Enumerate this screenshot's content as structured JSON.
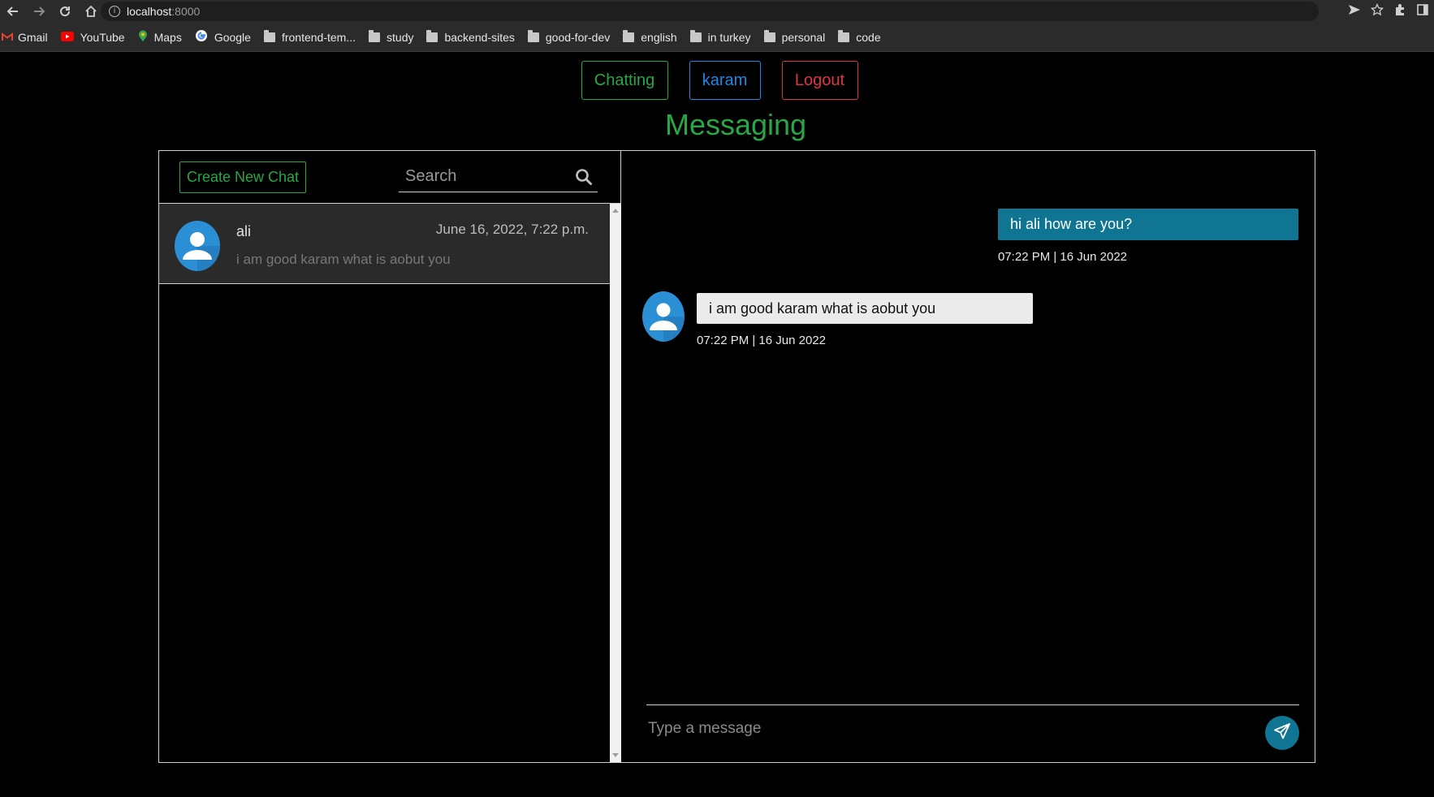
{
  "browser": {
    "url_host": "localhost",
    "url_port": ":8000",
    "bookmarks": [
      {
        "label": "Gmail",
        "icon": "gmail-icon"
      },
      {
        "label": "YouTube",
        "icon": "youtube-icon"
      },
      {
        "label": "Maps",
        "icon": "maps-icon"
      },
      {
        "label": "Google",
        "icon": "google-icon"
      },
      {
        "label": "frontend-tem...",
        "icon": "folder-icon"
      },
      {
        "label": "study",
        "icon": "folder-icon"
      },
      {
        "label": "backend-sites",
        "icon": "folder-icon"
      },
      {
        "label": "good-for-dev",
        "icon": "folder-icon"
      },
      {
        "label": "english",
        "icon": "folder-icon"
      },
      {
        "label": "in turkey",
        "icon": "folder-icon"
      },
      {
        "label": "personal",
        "icon": "folder-icon"
      },
      {
        "label": "code",
        "icon": "folder-icon"
      }
    ]
  },
  "nav": {
    "chatting_label": "Chatting",
    "user_label": "karam",
    "logout_label": "Logout"
  },
  "page": {
    "title": "Messaging"
  },
  "sidebar": {
    "new_chat_label": "Create New Chat",
    "search_placeholder": "Search",
    "chats": [
      {
        "name": "ali",
        "date": "June 16, 2022, 7:22 p.m.",
        "last_message": "i am good karam what is aobut you"
      }
    ]
  },
  "conversation": {
    "messages": [
      {
        "direction": "outgoing",
        "text": "hi ali how are you?",
        "time": "07:22 PM | 16 Jun 2022"
      },
      {
        "direction": "incoming",
        "text": "i am good karam what is aobut you",
        "time": "07:22 PM | 16 Jun 2022"
      }
    ],
    "compose_placeholder": "Type a message"
  },
  "colors": {
    "accent_green": "#28a745",
    "accent_blue": "#1e88e5",
    "accent_red": "#dc3545",
    "outgoing_bubble": "#0f7592",
    "incoming_bubble": "#ebebeb"
  }
}
